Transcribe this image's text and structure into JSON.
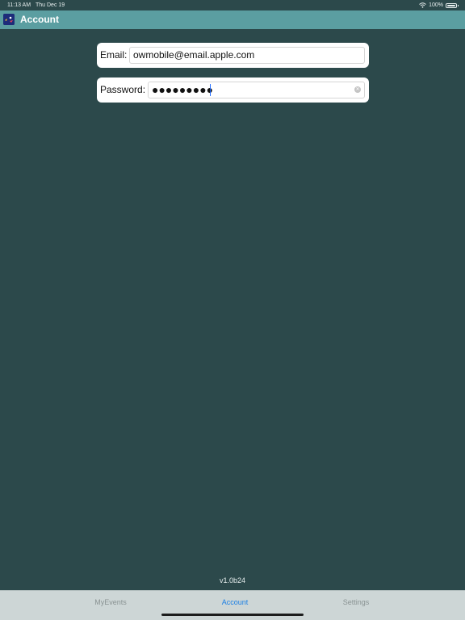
{
  "status_bar": {
    "time": "11:13 AM",
    "date": "Thu Dec 19",
    "battery": "100%"
  },
  "nav": {
    "title": "Account",
    "logo_icon": "app-logo-icon"
  },
  "form": {
    "email_label": "Email:",
    "email_value": "owmobile@email.apple.com",
    "password_label": "Password:",
    "password_value": "●●●●●●●●●"
  },
  "footer": {
    "version": "v1.0b24"
  },
  "tabs": [
    {
      "label": "MyEvents",
      "selected": false
    },
    {
      "label": "Account",
      "selected": true
    },
    {
      "label": "Settings",
      "selected": false
    }
  ],
  "colors": {
    "background": "#2c494b",
    "nav_bar": "#5b9ea1",
    "tab_selected": "#1b7fe3",
    "tab_unselected": "#8a9393"
  }
}
